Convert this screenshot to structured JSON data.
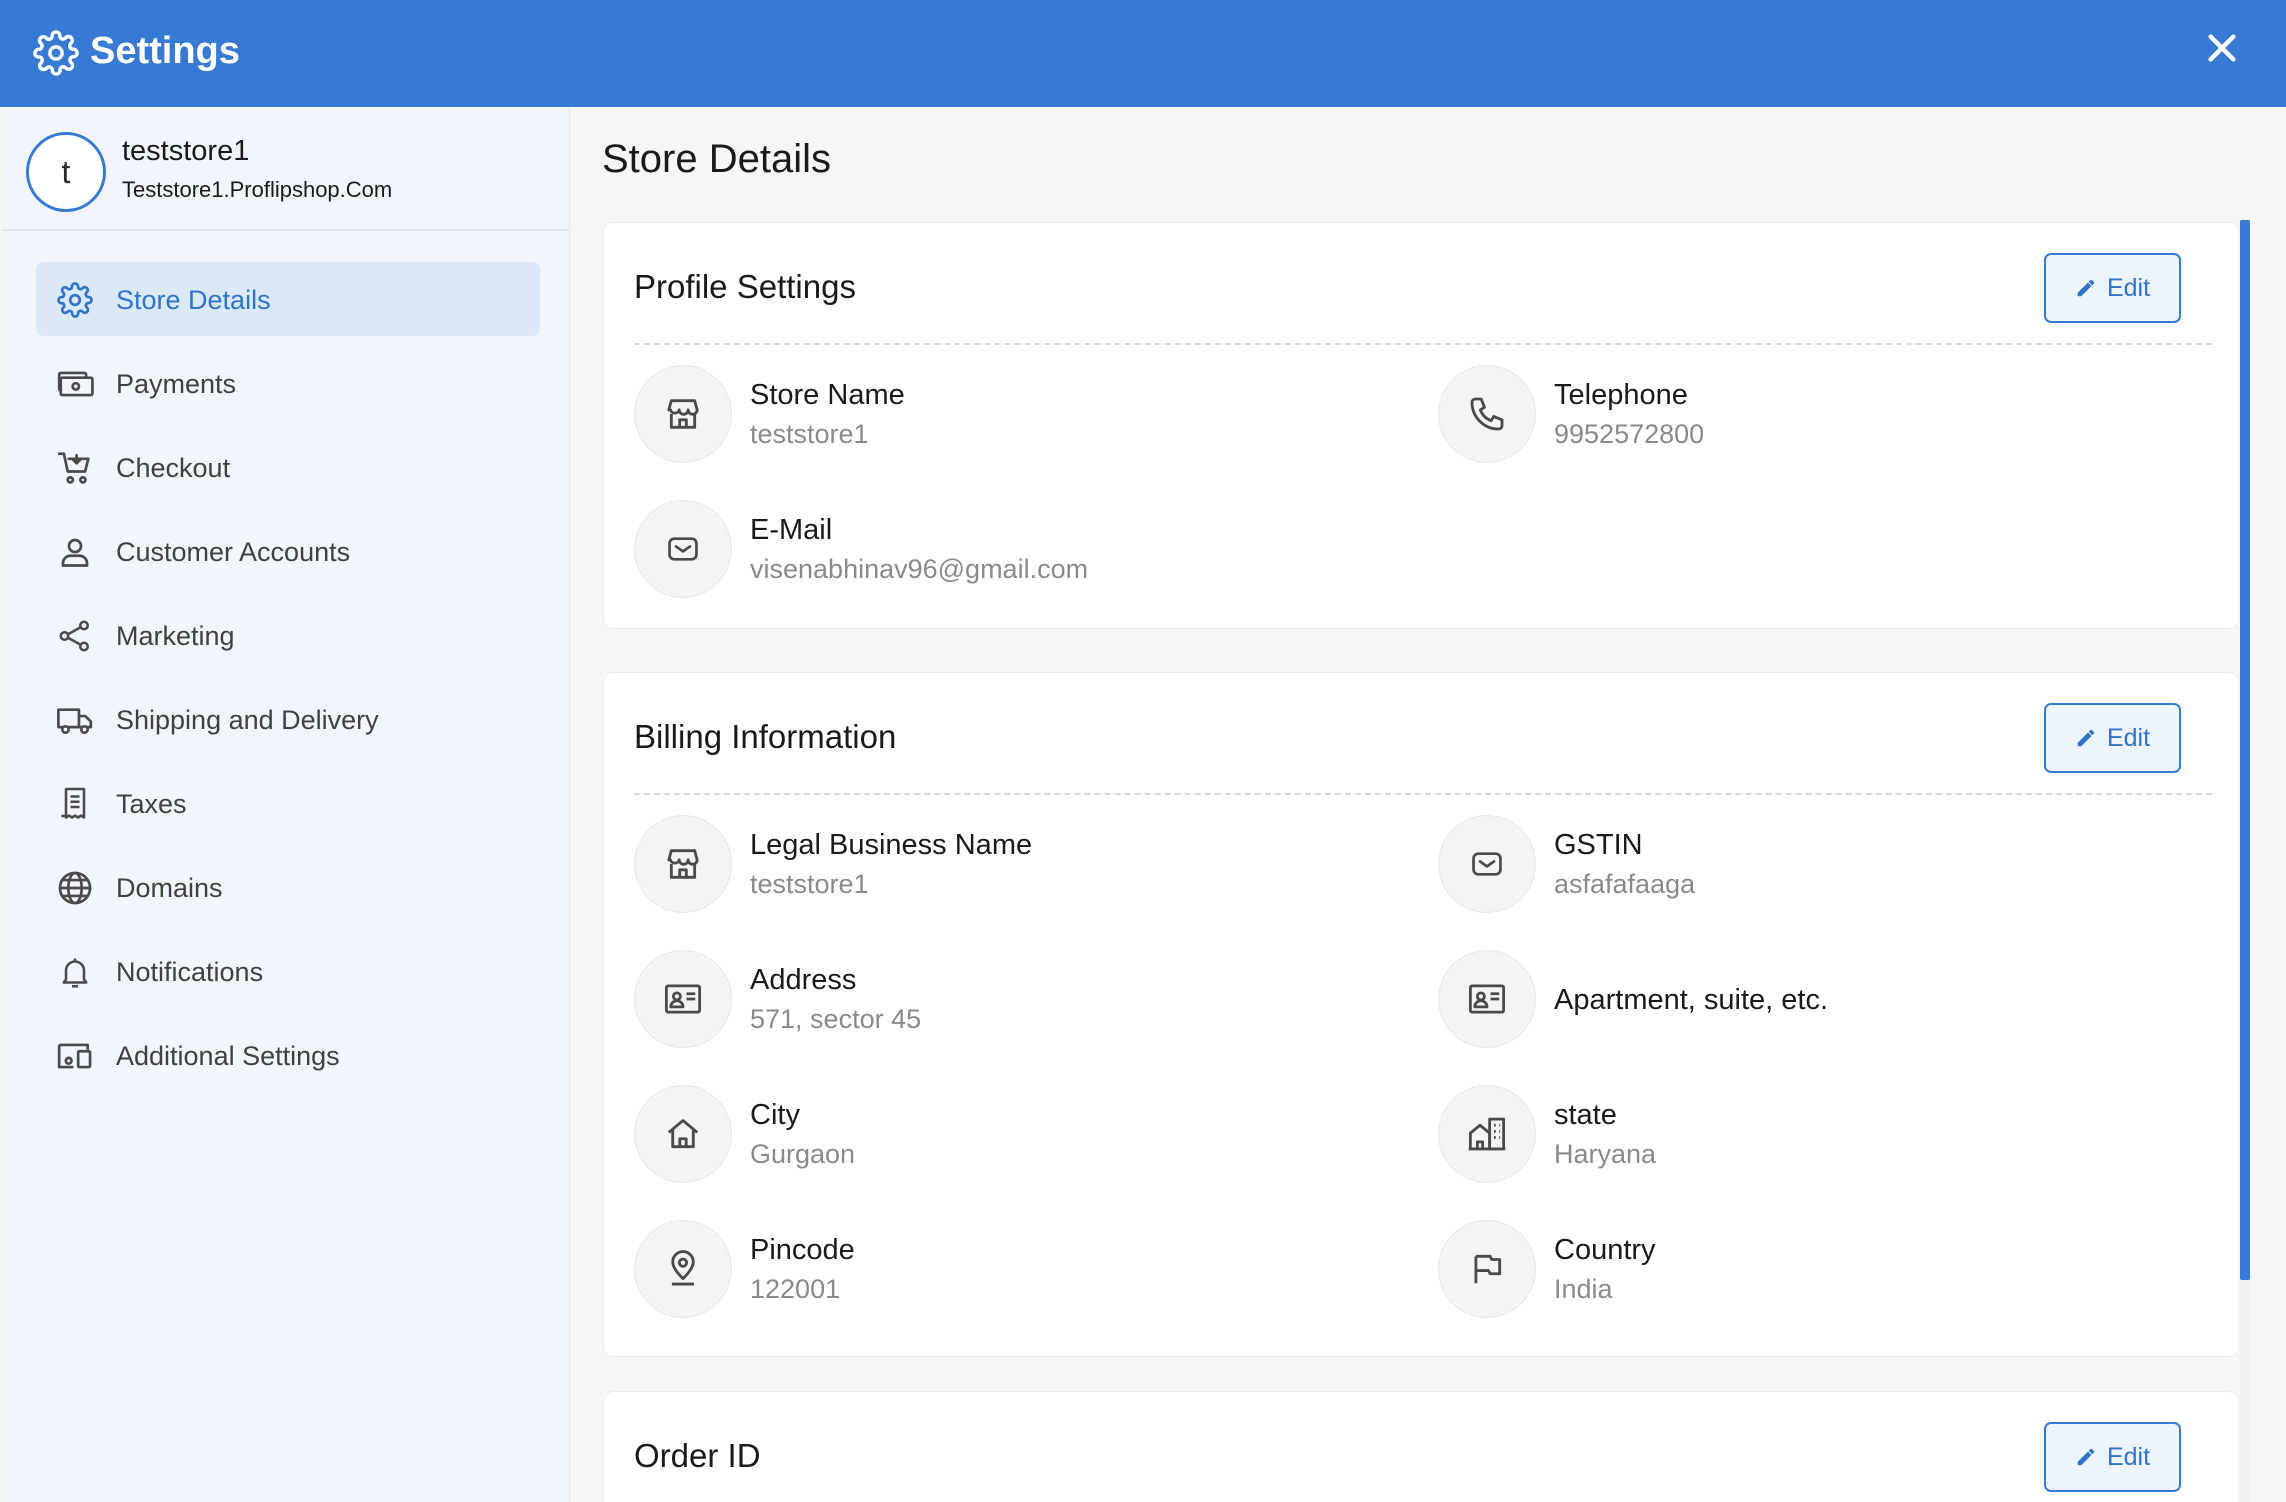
{
  "header": {
    "title": "Settings",
    "icon": "gear-icon",
    "close_icon": "close-icon",
    "color": "#367ad4"
  },
  "store": {
    "avatar_letter": "t",
    "name": "teststore1",
    "url": "Teststore1.Proflipshop.Com"
  },
  "sidebar": {
    "items": [
      {
        "label": "Store Details",
        "icon": "gear-icon",
        "active": true
      },
      {
        "label": "Payments",
        "icon": "payments-icon"
      },
      {
        "label": "Checkout",
        "icon": "cart-icon"
      },
      {
        "label": "Customer Accounts",
        "icon": "user-icon"
      },
      {
        "label": "Marketing",
        "icon": "share-icon"
      },
      {
        "label": "Shipping and Delivery",
        "icon": "truck-icon"
      },
      {
        "label": "Taxes",
        "icon": "receipt-icon"
      },
      {
        "label": "Domains",
        "icon": "globe-icon"
      },
      {
        "label": "Notifications",
        "icon": "bell-icon"
      },
      {
        "label": "Additional Settings",
        "icon": "devices-icon"
      }
    ]
  },
  "main": {
    "title": "Store Details",
    "edit_label": "Edit",
    "profile": {
      "title": "Profile Settings",
      "store_name": {
        "label": "Store Name",
        "value": "teststore1"
      },
      "telephone": {
        "label": "Telephone",
        "value": "9952572800"
      },
      "email": {
        "label": "E-Mail",
        "value": "visenabhinav96@gmail.com"
      }
    },
    "billing": {
      "title": "Billing Information",
      "legal_name": {
        "label": "Legal Business Name",
        "value": "teststore1"
      },
      "gstin": {
        "label": "GSTIN",
        "value": "asfafafaaga"
      },
      "address": {
        "label": "Address",
        "value": "571, sector 45"
      },
      "apartment": {
        "label": "Apartment, suite, etc."
      },
      "city": {
        "label": "City",
        "value": "Gurgaon"
      },
      "state": {
        "label": "state",
        "value": "Haryana"
      },
      "pincode": {
        "label": "Pincode",
        "value": "122001"
      },
      "country": {
        "label": "Country",
        "value": "India"
      }
    },
    "order": {
      "title": "Order ID"
    }
  }
}
